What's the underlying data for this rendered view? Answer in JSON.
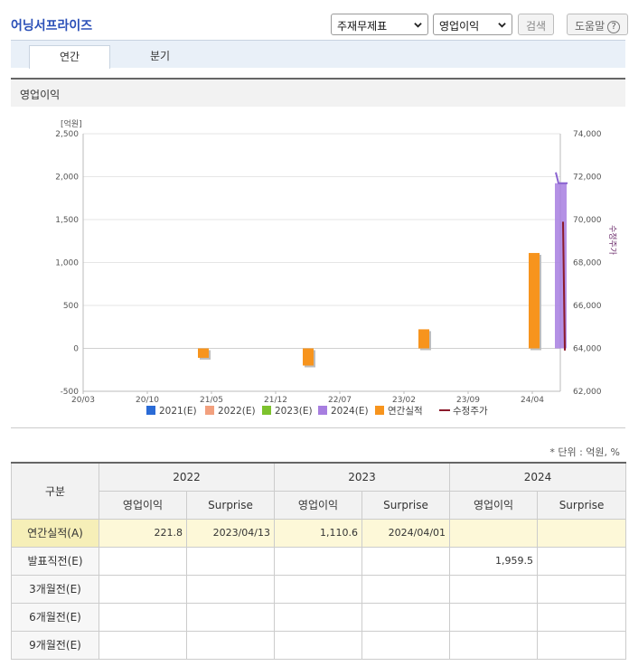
{
  "app": {
    "title": "어닝서프라이즈"
  },
  "controls": {
    "report_select": "주재무제표",
    "item_select": "영업이익",
    "search_button": "검색",
    "help_button": "도움말",
    "help_icon_glyph": "?"
  },
  "tabs": [
    {
      "label": "연간",
      "active": true
    },
    {
      "label": "분기",
      "active": false
    }
  ],
  "section": {
    "title": "영업이익"
  },
  "chart_data": {
    "type": "bar",
    "left_axis_unit": "[억원]",
    "right_axis_label": "수정주가",
    "y_left_ticks": [
      "2,500",
      "2,000",
      "1,500",
      "1,000",
      "500",
      "0",
      "-500"
    ],
    "y_left_range": [
      -500,
      2500
    ],
    "y_right_ticks": [
      "74,000",
      "72,000",
      "70,000",
      "68,000",
      "66,000",
      "64,000",
      "62,000"
    ],
    "y_right_range": [
      62000,
      74000
    ],
    "x_ticks": [
      "20/03",
      "20/10",
      "21/05",
      "21/12",
      "22/07",
      "23/02",
      "23/09",
      "24/04"
    ],
    "series": [
      {
        "name": "연간실적",
        "color": "#f7941d",
        "points": [
          {
            "x": "2021",
            "y": -110
          },
          {
            "x": "2022",
            "y": -200
          },
          {
            "x": "2023",
            "y": 222
          },
          {
            "x": "2024",
            "y": 1111
          }
        ]
      },
      {
        "name": "2024(E)",
        "color": "#a77ee0",
        "range_y": [
          0,
          2050
        ]
      },
      {
        "name": "수정주가",
        "color": "#8b1a2b",
        "points": [
          {
            "x": "24/05",
            "y": 69900
          },
          {
            "x": "24/06",
            "y": 63900
          }
        ]
      }
    ],
    "legend": [
      {
        "label": "2021(E)",
        "color": "#2a6bd6",
        "marker": "square"
      },
      {
        "label": "2022(E)",
        "color": "#f2a07e",
        "marker": "square"
      },
      {
        "label": "2023(E)",
        "color": "#7dc22d",
        "marker": "square"
      },
      {
        "label": "2024(E)",
        "color": "#a77ee0",
        "marker": "square"
      },
      {
        "label": "연간실적",
        "color": "#f7941d",
        "marker": "square"
      },
      {
        "label": "수정주가",
        "color": "#8b1a2b",
        "marker": "line"
      }
    ],
    "grid": true,
    "legend_placement": "bottom"
  },
  "unit_note": "* 단위 : 억원, %",
  "table": {
    "corner_header": "구분",
    "year_headers": [
      "2022",
      "2023",
      "2024"
    ],
    "sub_headers": [
      "영업이익",
      "Surprise",
      "영업이익",
      "Surprise",
      "영업이익",
      "Surprise"
    ],
    "rows": [
      {
        "label": "연간실적(A)",
        "cells": [
          "221.8",
          "2023/04/13",
          "1,110.6",
          "2024/04/01",
          "",
          ""
        ],
        "highlight": true
      },
      {
        "label": "발표직전(E)",
        "cells": [
          "",
          "",
          "",
          "",
          "1,959.5",
          ""
        ],
        "highlight": false
      },
      {
        "label": "3개월전(E)",
        "cells": [
          "",
          "",
          "",
          "",
          "",
          ""
        ],
        "highlight": false
      },
      {
        "label": "6개월전(E)",
        "cells": [
          "",
          "",
          "",
          "",
          "",
          ""
        ],
        "highlight": false
      },
      {
        "label": "9개월전(E)",
        "cells": [
          "",
          "",
          "",
          "",
          "",
          ""
        ],
        "highlight": false
      }
    ]
  }
}
